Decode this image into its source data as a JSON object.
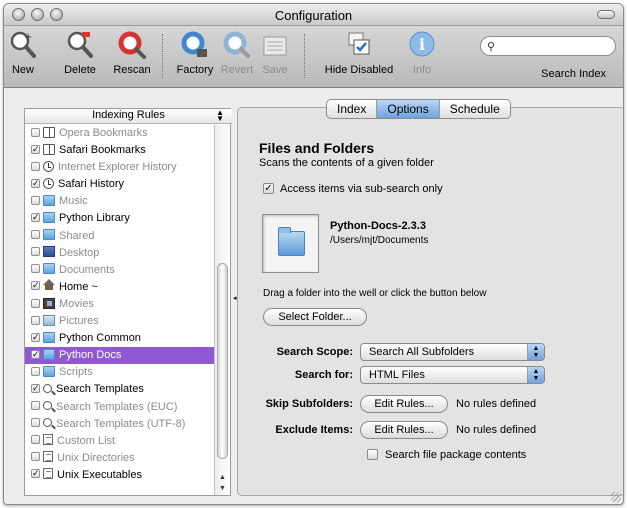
{
  "window": {
    "title": "Configuration"
  },
  "toolbar": {
    "items": [
      {
        "label": "New",
        "icon": "new-rule-icon",
        "enabled": true
      },
      {
        "label": "Delete",
        "icon": "delete-rule-icon",
        "enabled": true
      },
      {
        "label": "Rescan",
        "icon": "rescan-icon",
        "enabled": true
      },
      {
        "label": "Factory",
        "icon": "factory-icon",
        "enabled": true
      },
      {
        "label": "Revert",
        "icon": "revert-icon",
        "enabled": false
      },
      {
        "label": "Save",
        "icon": "save-icon",
        "enabled": false
      },
      {
        "label": "Hide Disabled",
        "icon": "hide-disabled-icon",
        "enabled": true
      },
      {
        "label": "Info",
        "icon": "info-icon",
        "enabled": false
      }
    ],
    "search_label": "Search Index",
    "search_value": ""
  },
  "sidebar": {
    "header": "Indexing Rules",
    "items": [
      {
        "label": "Opera Bookmarks",
        "checked": false,
        "icon": "bookmark-icon",
        "selected": false
      },
      {
        "label": "Safari Bookmarks",
        "checked": true,
        "icon": "bookmark-icon",
        "selected": false
      },
      {
        "label": "Internet Explorer History",
        "checked": false,
        "icon": "history-clock-icon",
        "selected": false
      },
      {
        "label": "Safari History",
        "checked": true,
        "icon": "history-clock-icon",
        "selected": false
      },
      {
        "label": "Music",
        "checked": false,
        "icon": "folder-icon",
        "selected": false
      },
      {
        "label": "Python Library",
        "checked": true,
        "icon": "folder-icon",
        "selected": false
      },
      {
        "label": "Shared",
        "checked": false,
        "icon": "folder-icon",
        "selected": false
      },
      {
        "label": "Desktop",
        "checked": false,
        "icon": "desktop-icon",
        "selected": false
      },
      {
        "label": "Documents",
        "checked": false,
        "icon": "documents-folder-icon",
        "selected": false
      },
      {
        "label": "Home ~",
        "checked": true,
        "icon": "home-icon",
        "selected": false
      },
      {
        "label": "Movies",
        "checked": false,
        "icon": "movies-icon",
        "selected": false
      },
      {
        "label": "Pictures",
        "checked": false,
        "icon": "pictures-icon",
        "selected": false
      },
      {
        "label": "Python Common",
        "checked": true,
        "icon": "folder-icon",
        "selected": false
      },
      {
        "label": "Python Docs",
        "checked": true,
        "icon": "folder-icon",
        "selected": true
      },
      {
        "label": "Scripts",
        "checked": false,
        "icon": "folder-icon",
        "selected": false
      },
      {
        "label": "Search Templates",
        "checked": true,
        "icon": "search-icon",
        "selected": false
      },
      {
        "label": "Search Templates (EUC)",
        "checked": false,
        "icon": "search-icon",
        "selected": false
      },
      {
        "label": "Search Templates (UTF-8)",
        "checked": false,
        "icon": "search-icon",
        "selected": false
      },
      {
        "label": "Custom List",
        "checked": false,
        "icon": "document-icon",
        "selected": false
      },
      {
        "label": "Unix Directories",
        "checked": false,
        "icon": "document-icon",
        "selected": false
      },
      {
        "label": "Unix Executables",
        "checked": true,
        "icon": "document-icon",
        "selected": false
      }
    ]
  },
  "tabs": [
    {
      "label": "Index",
      "active": false
    },
    {
      "label": "Options",
      "active": true
    },
    {
      "label": "Schedule",
      "active": false
    }
  ],
  "options": {
    "section_title": "Files and Folders",
    "section_subtitle": "Scans the contents of a given folder",
    "access_label": "Access items via sub-search only",
    "access_checked": true,
    "folder_name": "Python-Docs-2.3.3",
    "folder_path": "/Users/mjt/Documents",
    "drag_hint": "Drag a folder into the well or click the button below",
    "select_folder_button": "Select Folder...",
    "search_scope_label": "Search Scope:",
    "search_scope_value": "Search All Subfolders",
    "search_for_label": "Search for:",
    "search_for_value": "HTML Files",
    "skip_subfolders_label": "Skip Subfolders:",
    "skip_edit_button": "Edit Rules...",
    "skip_status": "No rules defined",
    "exclude_items_label": "Exclude Items:",
    "exclude_edit_button": "Edit Rules...",
    "exclude_status": "No rules defined",
    "package_label": "Search file package contents",
    "package_checked": false
  },
  "colors": {
    "selection": "#9257d3",
    "accent_blue": "#6fa2df"
  }
}
